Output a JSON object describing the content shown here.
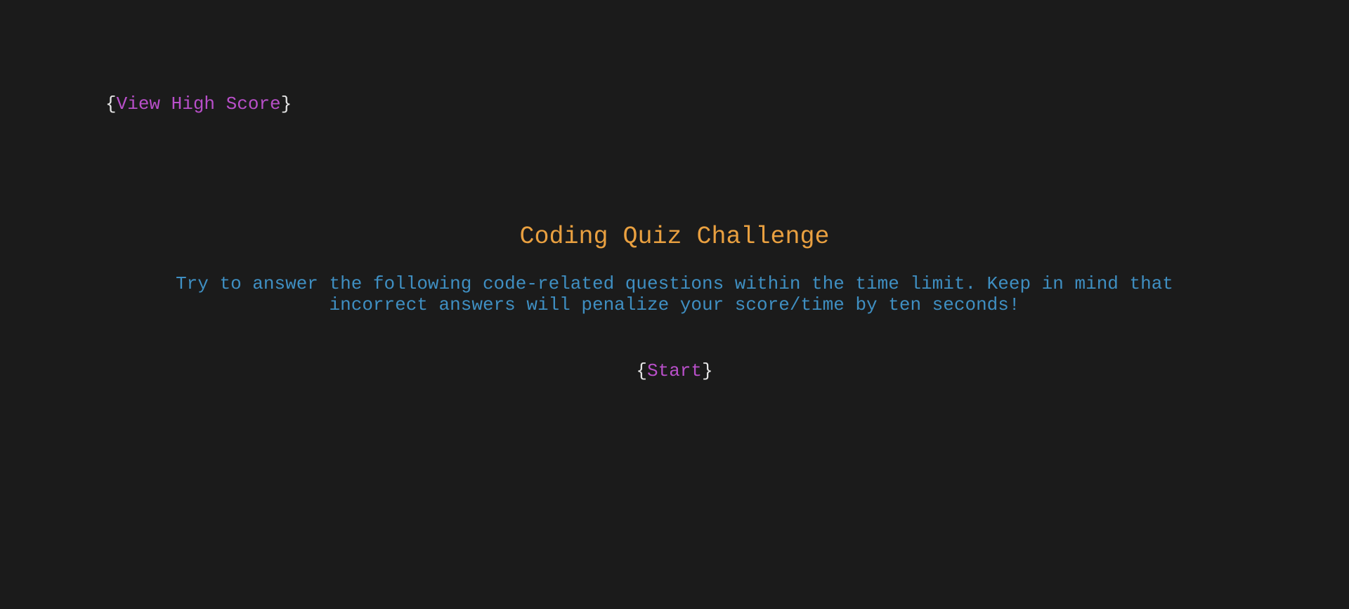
{
  "nav": {
    "high_score": {
      "open_brace": "{",
      "label": "View High Score",
      "close_brace": "}"
    }
  },
  "main": {
    "title": "Coding Quiz Challenge",
    "description": "Try to answer the following code-related questions within the time limit. Keep in mind that incorrect answers will penalize your score/time by ten seconds!",
    "start": {
      "open_brace": "{",
      "label": "Start",
      "close_brace": "}"
    }
  },
  "colors": {
    "background": "#1b1b1b",
    "title": "#e9a040",
    "description": "#3f8fc2",
    "link": "#b84fc9",
    "brace": "#e6e6e6"
  }
}
